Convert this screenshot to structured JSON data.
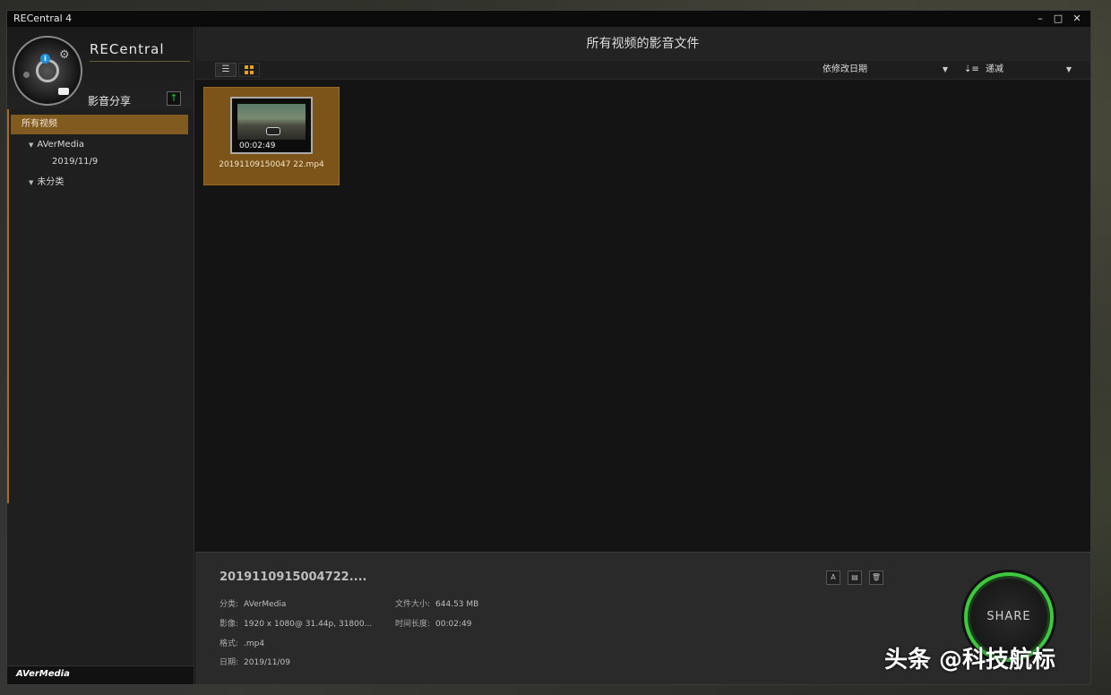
{
  "window": {
    "title": "RECentral 4",
    "minimize": "–",
    "maximize": "□",
    "close": "✕"
  },
  "sidebar": {
    "brand": "RECentral",
    "share_label": "影音分享",
    "upload_icon": "↑",
    "nav_all": "所有视频",
    "tree": [
      {
        "label": "AVerMedia"
      },
      {
        "label": "2019/11/9"
      },
      {
        "label": "未分类"
      }
    ],
    "footer_brand": "AVerMedia"
  },
  "main": {
    "title": "所有视频的影音文件",
    "list_view_icon": "☰",
    "sort_field": "依修改日期",
    "sort_order": "递减",
    "sort_order_icon": "⇣≡"
  },
  "tile": {
    "duration": "00:02:49",
    "filename": "20191109150047 22.mp4"
  },
  "details": {
    "title": "2019110915004722....",
    "category_label": "分类:",
    "category_value": "AVerMedia",
    "video_label": "影像:",
    "video_value": "1920 x 1080@ 31.44p, 31800...",
    "format_label": "格式:",
    "format_value": ".mp4",
    "date_label": "日期:",
    "date_value": "2019/11/09",
    "size_label": "文件大小:",
    "size_value": "644.53 MB",
    "length_label": "时间长度:",
    "length_value": "00:02:49",
    "share_button": "SHARE"
  },
  "watermark": "头条 @科技航标"
}
